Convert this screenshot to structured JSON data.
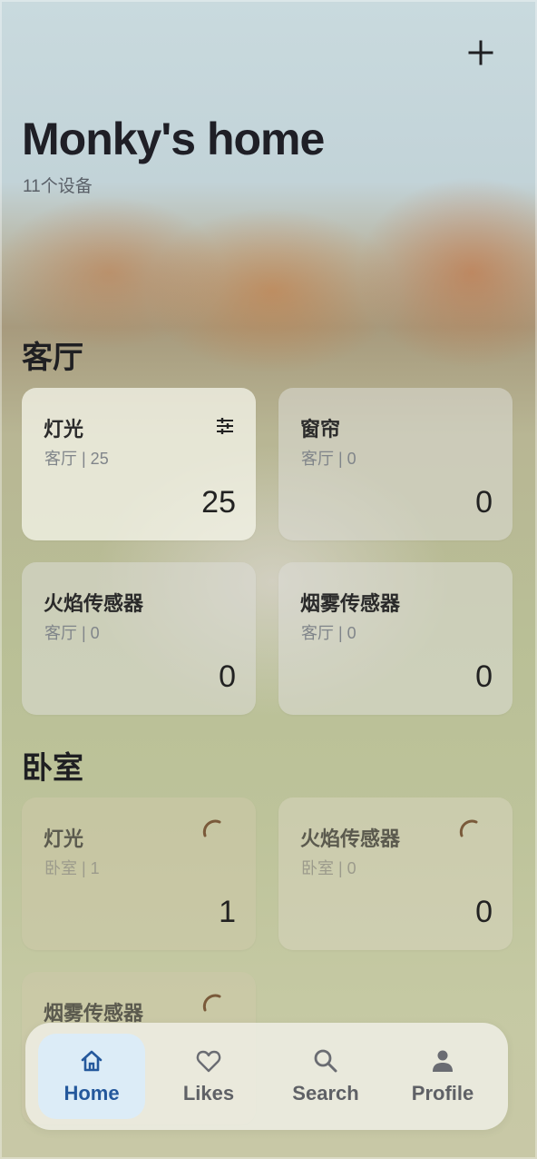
{
  "header": {
    "title": "Monky's home",
    "subtitle": "11个设备"
  },
  "sections": [
    {
      "title": "客厅",
      "cards": [
        {
          "name": "灯光",
          "meta": "客厅 | 25",
          "value": "25",
          "icon": "tune-icon"
        },
        {
          "name": "窗帘",
          "meta": "客厅 | 0",
          "value": "0"
        },
        {
          "name": "火焰传感器",
          "meta": "客厅 | 0",
          "value": "0"
        },
        {
          "name": "烟雾传感器",
          "meta": "客厅 | 0",
          "value": "0"
        }
      ]
    },
    {
      "title": "卧室",
      "cards": [
        {
          "name": "灯光",
          "meta": "卧室 | 1",
          "value": "1",
          "icon": "loading-spinner-icon"
        },
        {
          "name": "火焰传感器",
          "meta": "卧室 | 0",
          "value": "0",
          "icon": "loading-spinner-icon"
        },
        {
          "name": "烟雾传感器",
          "icon": "loading-spinner-icon"
        }
      ]
    }
  ],
  "nav": {
    "items": [
      {
        "label": "Home",
        "icon": "home-icon",
        "active": true
      },
      {
        "label": "Likes",
        "icon": "heart-icon"
      },
      {
        "label": "Search",
        "icon": "search-icon"
      },
      {
        "label": "Profile",
        "icon": "profile-icon"
      }
    ]
  },
  "colors": {
    "active_nav_bg": "#dcecf7",
    "active_nav_text": "#24589c",
    "spinner": "#7a5a3a"
  }
}
